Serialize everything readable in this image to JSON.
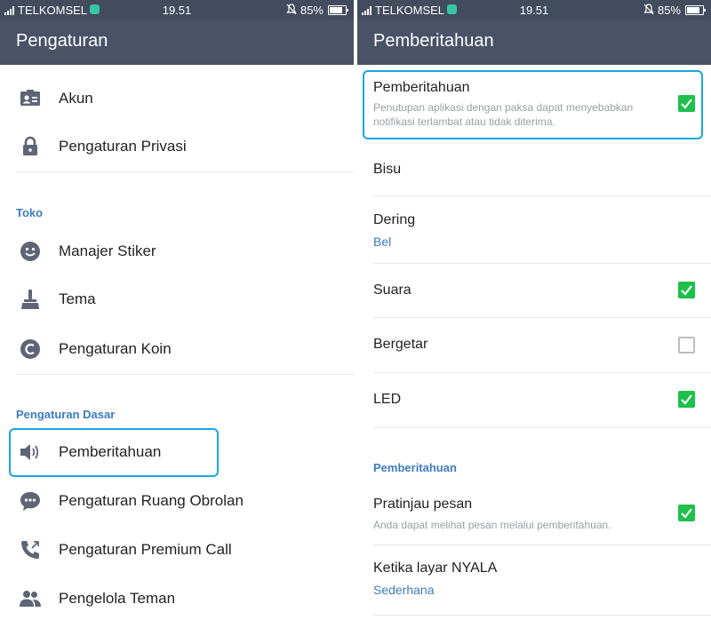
{
  "status_bar": {
    "carrier": "TELKOMSEL",
    "time": "19.51",
    "battery": "85%"
  },
  "left": {
    "title": "Pengaturan",
    "items_top": [
      {
        "icon": "id-card-icon",
        "label": "Akun"
      },
      {
        "icon": "lock-icon",
        "label": "Pengaturan Privasi"
      }
    ],
    "section_toko": "Toko",
    "items_toko": [
      {
        "icon": "smiley-icon",
        "label": "Manajer Stiker"
      },
      {
        "icon": "brush-icon",
        "label": "Tema"
      },
      {
        "icon": "coin-icon",
        "label": "Pengaturan Koin"
      }
    ],
    "section_dasar": "Pengaturan Dasar",
    "items_dasar": [
      {
        "icon": "speaker-icon",
        "label": "Pemberitahuan"
      },
      {
        "icon": "chat-bubble-icon",
        "label": "Pengaturan Ruang Obrolan"
      },
      {
        "icon": "phone-call-icon",
        "label": "Pengaturan Premium Call"
      },
      {
        "icon": "friends-icon",
        "label": "Pengelola Teman"
      }
    ]
  },
  "right": {
    "title": "Pemberitahuan",
    "notif": {
      "label": "Pemberitahuan",
      "desc_line1": "Penutupan aplikasi dengan paksa dapat menyebabkan",
      "desc_line2": "notifikasi terlambat atau tidak diterima.",
      "checked": true
    },
    "mute": {
      "label": "Bisu"
    },
    "ring": {
      "label": "Dering",
      "value": "Bel"
    },
    "sound": {
      "label": "Suara",
      "checked": true
    },
    "vibrate": {
      "label": "Bergetar",
      "checked": false
    },
    "led": {
      "label": "LED",
      "checked": true
    },
    "section": "Pemberitahuan",
    "preview": {
      "label": "Pratinjau pesan",
      "desc": "Anda dapat melihat pesan melalui pemberitahuan.",
      "checked": true
    },
    "screen_on": {
      "label": "Ketika layar NYALA",
      "value": "Sederhana"
    }
  },
  "colors": {
    "header": "#4a5267",
    "status": "#434b5e",
    "accent": "#3e7bc1",
    "check": "#1fc04a",
    "highlight": "#1aa6e3"
  }
}
